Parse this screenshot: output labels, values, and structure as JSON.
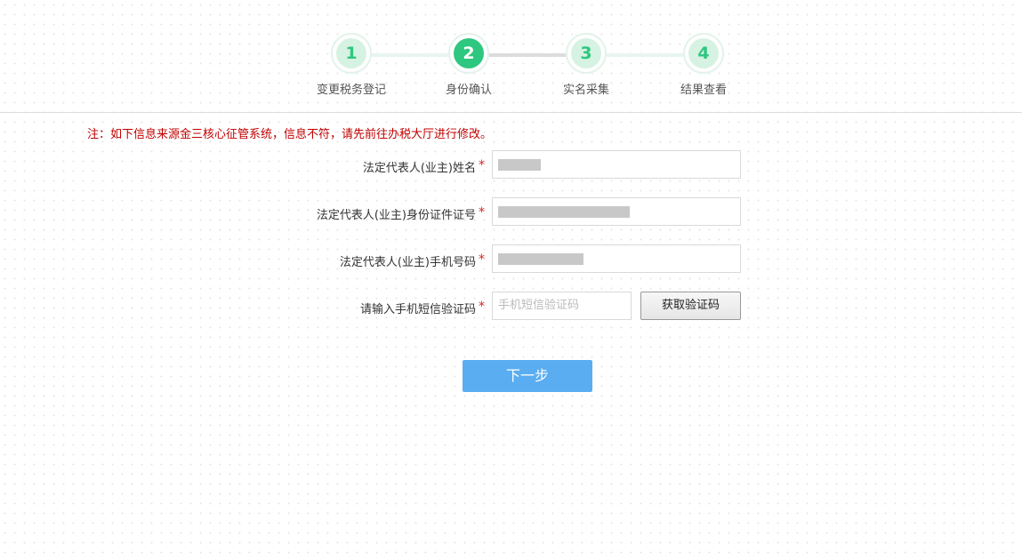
{
  "stepper": {
    "steps": [
      {
        "number": "1",
        "label": "变更税务登记"
      },
      {
        "number": "2",
        "label": "身份确认"
      },
      {
        "number": "3",
        "label": "实名采集"
      },
      {
        "number": "4",
        "label": "结果查看"
      }
    ],
    "active_step": "2"
  },
  "notice": "注：如下信息来源金三核心征管系统，信息不符，请先前往办税大厅进行修改。",
  "form": {
    "required_mark": "*",
    "name": {
      "label": "法定代表人(业主)姓名",
      "value_masked": true
    },
    "id_number": {
      "label": "法定代表人(业主)身份证件证号",
      "value_masked": true
    },
    "phone": {
      "label": "法定代表人(业主)手机号码",
      "value_masked": true
    },
    "sms_code": {
      "label": "请输入手机短信验证码",
      "placeholder": "手机短信验证码",
      "value": ""
    },
    "get_code_button": "获取验证码",
    "next_button": "下一步"
  },
  "colors": {
    "accent_green": "#2ec77f",
    "notice_red": "#c00000",
    "required_red": "#e02020",
    "primary_button_blue": "#5aadf0"
  }
}
